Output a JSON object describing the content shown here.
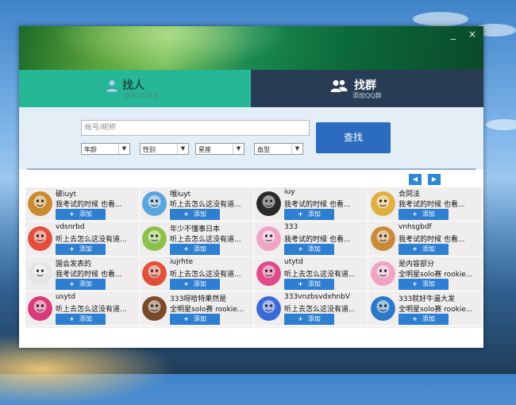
{
  "window": {
    "minimize_glyph": "_",
    "close_glyph": "×"
  },
  "tabs": {
    "person": {
      "title": "找人",
      "subtitle": "添加QQ好友"
    },
    "group": {
      "title": "找群",
      "subtitle": "添加QQ群"
    }
  },
  "search": {
    "placeholder": "帐号/昵称",
    "filters": [
      "年龄",
      "性别",
      "星座",
      "血型"
    ],
    "find_label": "查找"
  },
  "pager": {
    "prev": "◀",
    "next": "▶"
  },
  "add_label": "添加",
  "results": [
    {
      "name": "破iuyt",
      "desc": "我考试的时候 也看...",
      "avatar": "gold-ring",
      "color": "#c98a2e"
    },
    {
      "name": "哦iuyt",
      "desc": "听上去怎么这没有道...",
      "avatar": "blue-cloud",
      "color": "#5aa4e0"
    },
    {
      "name": "iuy",
      "desc": "我考试的时候 也看...",
      "avatar": "penguin",
      "color": "#2a2a2a"
    },
    {
      "name": "合同法",
      "desc": "我考试的时候 也看...",
      "avatar": "cartoon-boy",
      "color": "#e0b040"
    },
    {
      "name": "vdsnrbd",
      "desc": "听上去怎么这没有道...",
      "avatar": "monkey-red",
      "color": "#e2503a"
    },
    {
      "name": "年少不懂事日本",
      "desc": "听上去怎么这没有道...",
      "avatar": "monkey-green",
      "color": "#8cc04a"
    },
    {
      "name": "333",
      "desc": "我考试的时候 也看...",
      "avatar": "pink-frame",
      "color": "#f0a4c4"
    },
    {
      "name": "vnhsgbdf",
      "desc": "我考试的时候 也看...",
      "avatar": "cartoon-boy",
      "color": "#c98a3a"
    },
    {
      "name": "国会发表的",
      "desc": "我考试的时候 也看...",
      "avatar": "white-cat",
      "color": "#e6e6e6"
    },
    {
      "name": "iujrhte",
      "desc": "听上去怎么这没有道...",
      "avatar": "monkey-red",
      "color": "#e2503a"
    },
    {
      "name": "utytd",
      "desc": "听上去怎么这没有道...",
      "avatar": "pink-girl",
      "color": "#e04a8a"
    },
    {
      "name": "是内容部分",
      "desc": "全明星solo赛 rookie...",
      "avatar": "pink-frame",
      "color": "#f0a4c4"
    },
    {
      "name": "usytd",
      "desc": "听上去怎么这没有道...",
      "avatar": "pink-girl",
      "color": "#d83a7a"
    },
    {
      "name": "333呀哈特果然是",
      "desc": "全明星solo赛 rookie...",
      "avatar": "cake",
      "color": "#7a4a2a"
    },
    {
      "name": "333vnzbsvdxhnbV",
      "desc": "听上去怎么这没有道...",
      "avatar": "blue-girl",
      "color": "#3a6ad8"
    },
    {
      "name": "333就好牛逼大发",
      "desc": "全明星solo赛 rookie...",
      "avatar": "blue-bird",
      "color": "#2a78c8"
    }
  ]
}
